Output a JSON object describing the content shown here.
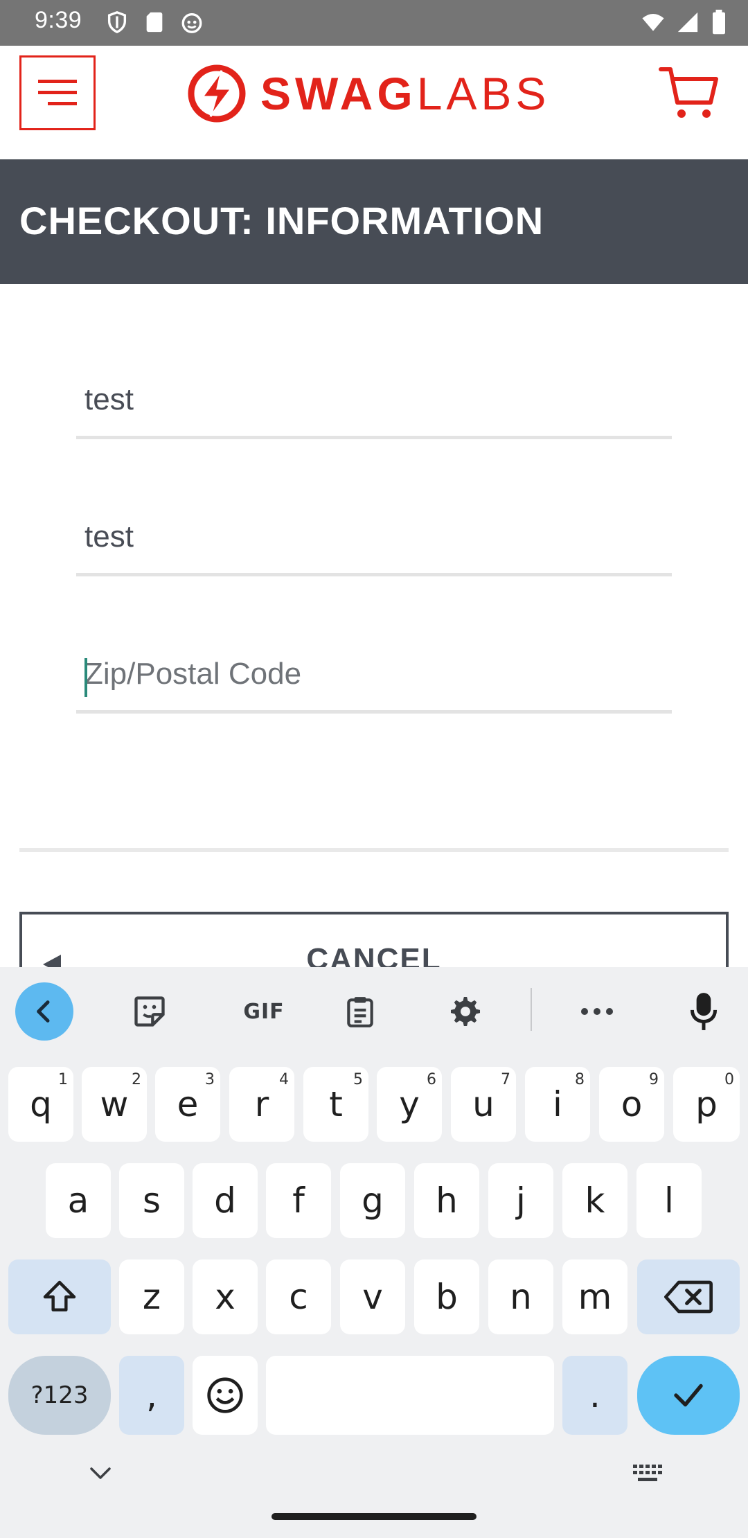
{
  "status_bar": {
    "time": "9:39",
    "left_icons": [
      "shield-icon",
      "sd-card-icon",
      "android-icon"
    ],
    "right_icons": [
      "wifi-icon",
      "signal-icon",
      "battery-icon"
    ]
  },
  "header": {
    "menu_icon": "hamburger-menu-icon",
    "logo_bold": "SWAG",
    "logo_light": "LABS",
    "cart_icon": "shopping-cart-icon",
    "brand_color": "#e2231a"
  },
  "page": {
    "title": "CHECKOUT: INFORMATION",
    "title_bar_color": "#474c55"
  },
  "form": {
    "first_name": {
      "value": "test"
    },
    "last_name": {
      "value": "test"
    },
    "postal_code": {
      "value": "",
      "placeholder": "Zip/Postal Code"
    }
  },
  "actions": {
    "cancel_label": "CANCEL"
  },
  "keyboard": {
    "toolbar": [
      "back-arrow-icon",
      "sticker-icon",
      "GIF",
      "clipboard-icon",
      "gear-icon",
      "more-icon",
      "microphone-icon"
    ],
    "row1": [
      {
        "k": "q",
        "h": "1"
      },
      {
        "k": "w",
        "h": "2"
      },
      {
        "k": "e",
        "h": "3"
      },
      {
        "k": "r",
        "h": "4"
      },
      {
        "k": "t",
        "h": "5"
      },
      {
        "k": "y",
        "h": "6"
      },
      {
        "k": "u",
        "h": "7"
      },
      {
        "k": "i",
        "h": "8"
      },
      {
        "k": "o",
        "h": "9"
      },
      {
        "k": "p",
        "h": "0"
      }
    ],
    "row2": [
      "a",
      "s",
      "d",
      "f",
      "g",
      "h",
      "j",
      "k",
      "l"
    ],
    "row3": [
      "z",
      "x",
      "c",
      "v",
      "b",
      "n",
      "m"
    ],
    "sym_label": "?123",
    "comma": ",",
    "period": ".",
    "accent_color": "#5ec2f5"
  },
  "nav": {
    "collapse_icon": "chevron-down-icon",
    "keyboard_switch_icon": "keyboard-icon"
  }
}
